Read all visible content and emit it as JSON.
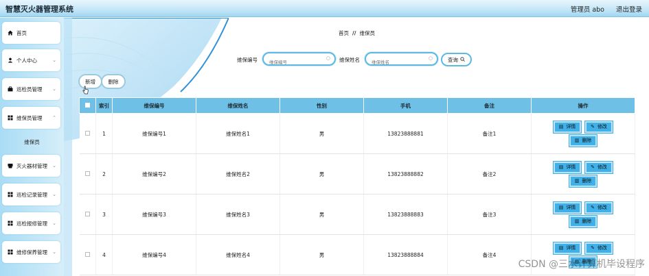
{
  "header": {
    "app_title": "智慧灭火器管理系统",
    "admin_label": "管理员 abo",
    "logout_label": "退出登录"
  },
  "sidebar": {
    "items": [
      {
        "label": "首页",
        "icon": "home-icon"
      },
      {
        "label": "个人中心",
        "icon": "user-icon"
      },
      {
        "label": "巡检员管理",
        "icon": "briefcase-icon"
      },
      {
        "label": "维保员管理",
        "icon": "grid-icon"
      },
      {
        "label": "灭火器材管理",
        "icon": "box-icon"
      },
      {
        "label": "巡检记录管理",
        "icon": "grid-icon"
      },
      {
        "label": "巡检报修管理",
        "icon": "grid-icon"
      },
      {
        "label": "维修保养管理",
        "icon": "grid-icon"
      }
    ],
    "sub_item": "维保员"
  },
  "breadcrumb": {
    "home": "首页",
    "separator": "//",
    "current": "维保员"
  },
  "search": {
    "field1_label": "维保编号",
    "field1_placeholder": "维保编号",
    "field2_label": "维保姓名",
    "field2_placeholder": "维保姓名",
    "query_label": "查询"
  },
  "actions": {
    "add_label": "新增",
    "delete_label": "删除"
  },
  "table": {
    "headers": [
      "索引",
      "维保编号",
      "维保姓名",
      "性别",
      "手机",
      "备注",
      "操作"
    ],
    "rows": [
      {
        "index": "1",
        "code": "维保编号1",
        "name": "维保姓名1",
        "gender": "男",
        "phone": "13823888881",
        "remark": "备注1"
      },
      {
        "index": "2",
        "code": "维保编号2",
        "name": "维保姓名2",
        "gender": "男",
        "phone": "13823888882",
        "remark": "备注2"
      },
      {
        "index": "3",
        "code": "维保编号3",
        "name": "维保姓名3",
        "gender": "男",
        "phone": "13823888883",
        "remark": "备注3"
      },
      {
        "index": "4",
        "code": "维保编号4",
        "name": "维保姓名4",
        "gender": "男",
        "phone": "13823888884",
        "remark": "备注4"
      }
    ],
    "row_actions": {
      "detail_label": "详情",
      "edit_label": "修改",
      "delete_label": "删除"
    }
  },
  "watermark": "CSDN @三水计算机毕设程序",
  "colors": {
    "accent": "#3fb0e8",
    "header_bg": "#6ec0e6",
    "sidebar_bg": "#a9dcf5"
  }
}
